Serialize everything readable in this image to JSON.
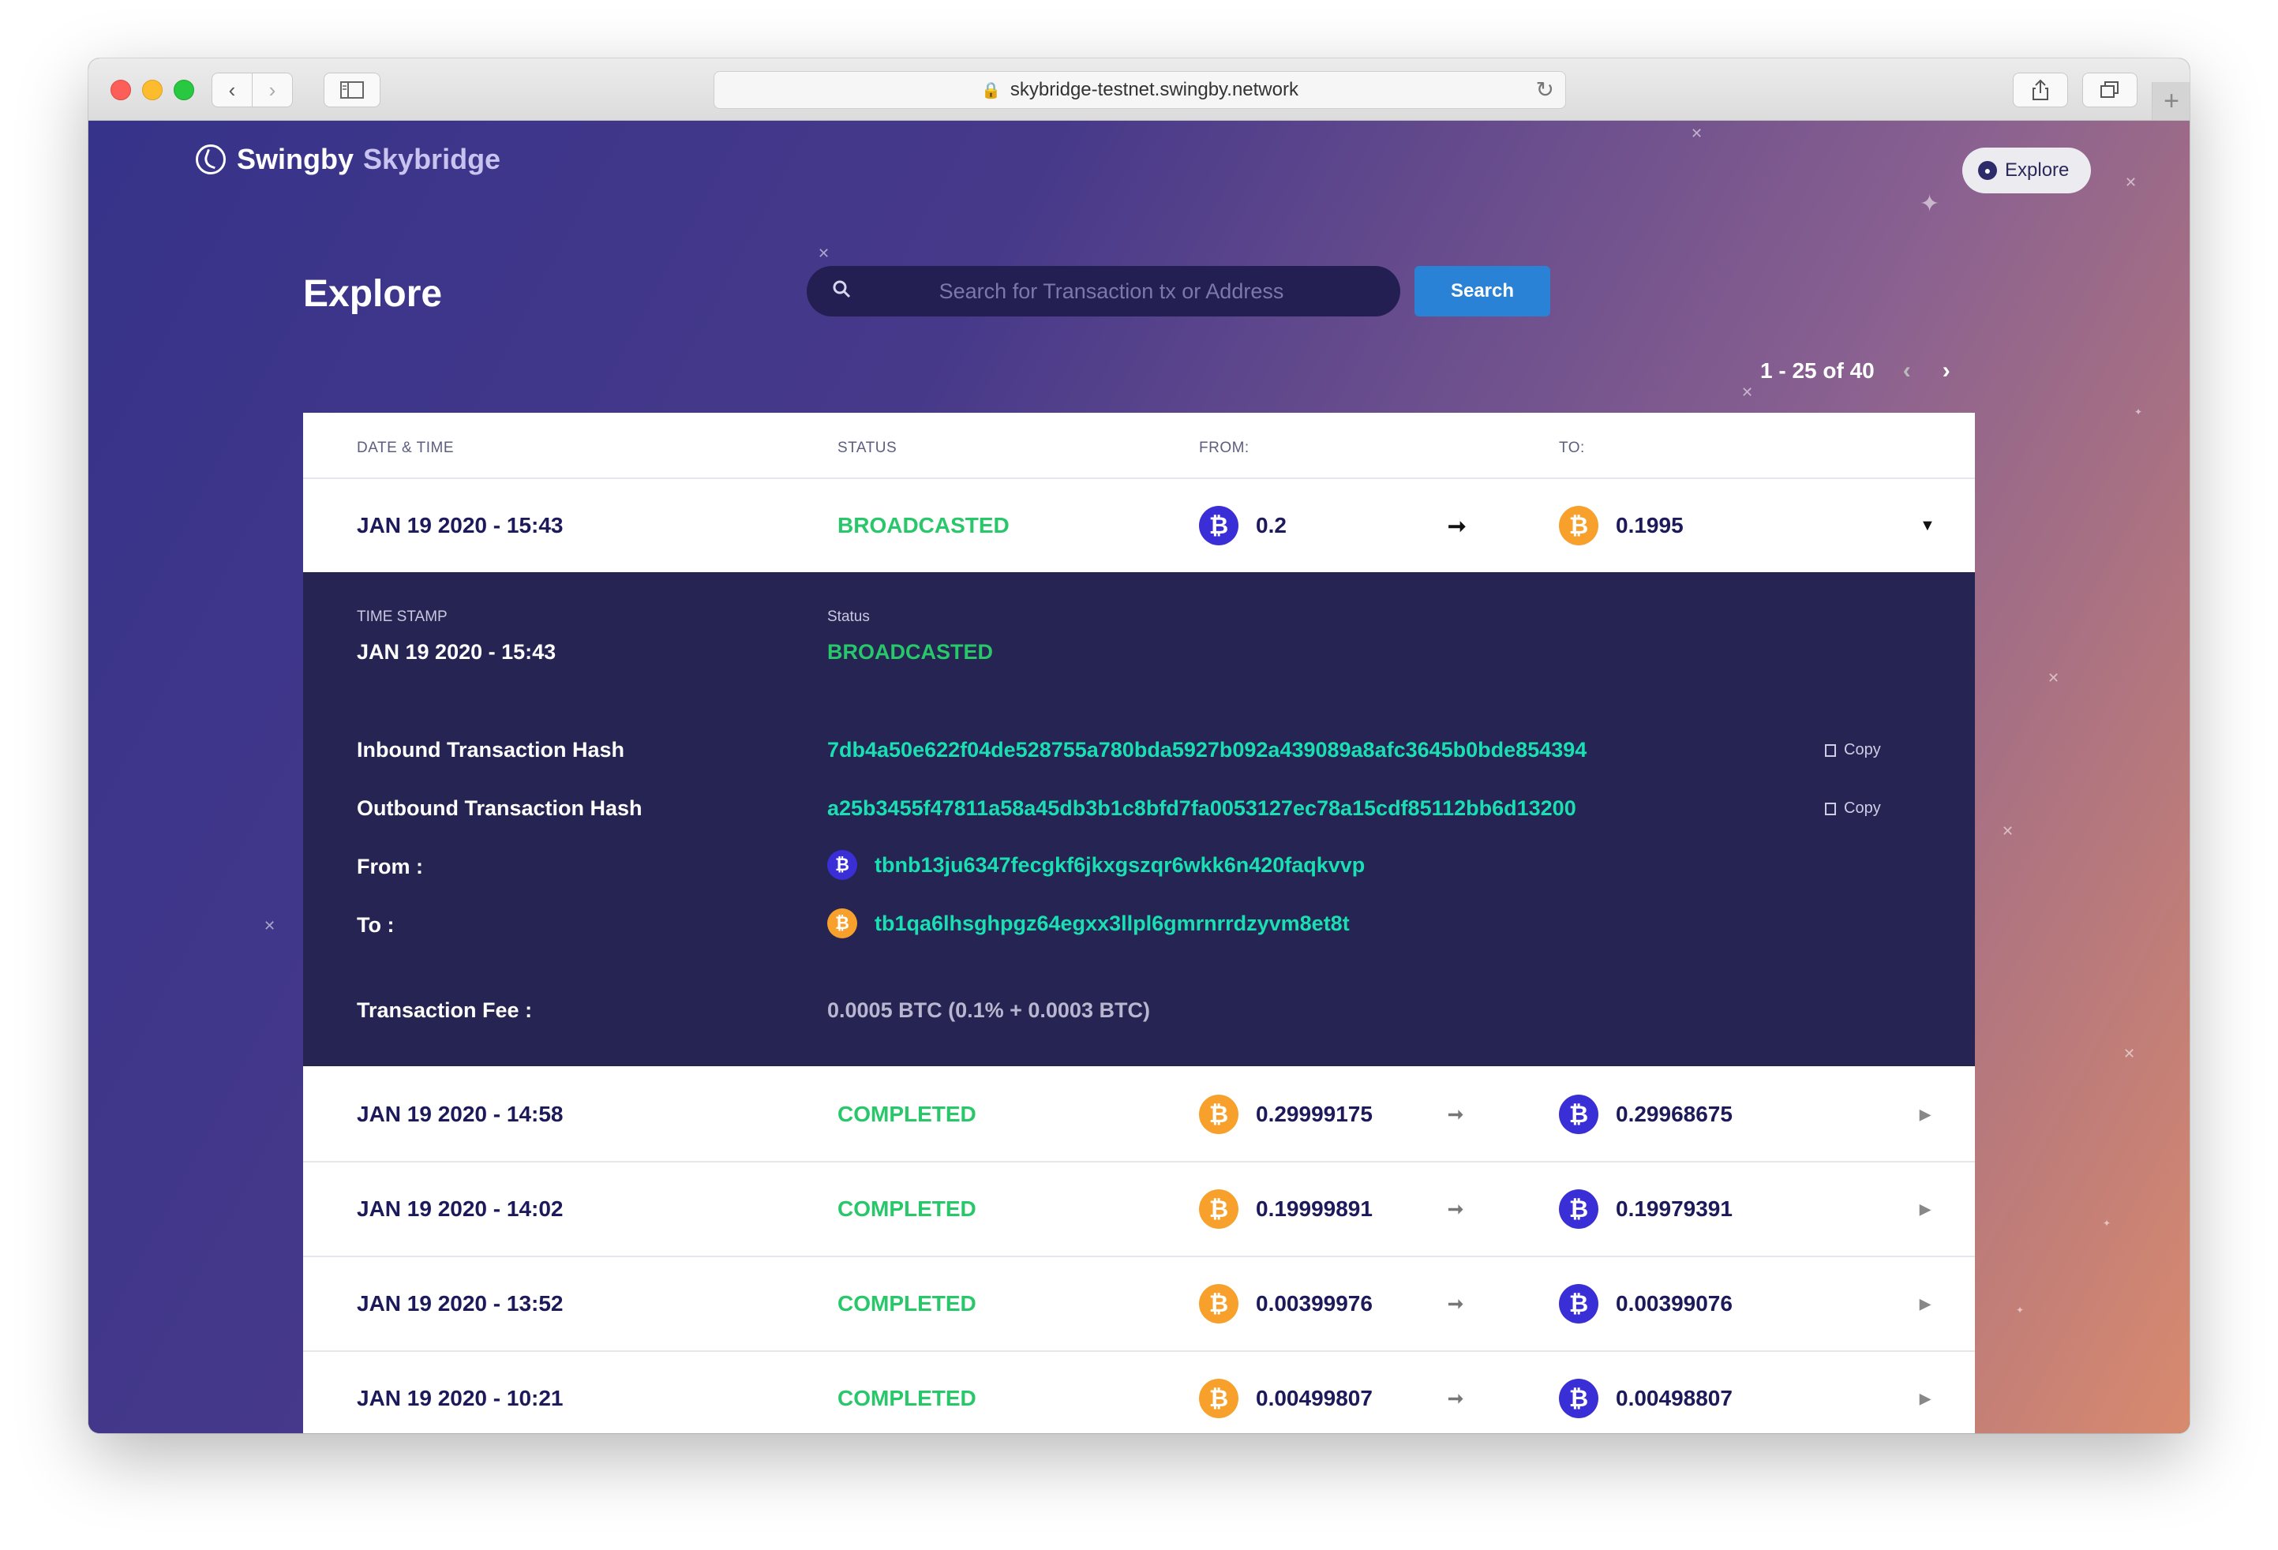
{
  "browser": {
    "url": "skybridge-testnet.swingby.network"
  },
  "header": {
    "brand_primary": "Swingby",
    "brand_secondary": "Skybridge",
    "explore_button": "Explore"
  },
  "page": {
    "title": "Explore",
    "search_placeholder": "Search for Transaction tx or Address",
    "search_button": "Search",
    "pagination": "1 - 25 of 40"
  },
  "table": {
    "columns": [
      "DATE & TIME",
      "STATUS",
      "FROM:",
      "TO:"
    ],
    "rows": [
      {
        "date": "JAN 19 2020 - 15:43",
        "status": "BROADCASTED",
        "from_amount": "0.2",
        "from_coin": "blue",
        "to_amount": "0.1995",
        "to_coin": "orange"
      },
      {
        "date": "JAN 19 2020 - 14:58",
        "status": "COMPLETED",
        "from_amount": "0.29999175",
        "from_coin": "orange",
        "to_amount": "0.29968675",
        "to_coin": "blue"
      },
      {
        "date": "JAN 19 2020 - 14:02",
        "status": "COMPLETED",
        "from_amount": "0.19999891",
        "from_coin": "orange",
        "to_amount": "0.19979391",
        "to_coin": "blue"
      },
      {
        "date": "JAN 19 2020 - 13:52",
        "status": "COMPLETED",
        "from_amount": "0.00399976",
        "from_coin": "orange",
        "to_amount": "0.00399076",
        "to_coin": "blue"
      },
      {
        "date": "JAN 19 2020 - 10:21",
        "status": "COMPLETED",
        "from_amount": "0.00499807",
        "from_coin": "orange",
        "to_amount": "0.00498807",
        "to_coin": "blue"
      }
    ]
  },
  "detail": {
    "timestamp_label": "TIME STAMP",
    "timestamp_value": "JAN 19 2020 - 15:43",
    "status_label": "Status",
    "status_value": "BROADCASTED",
    "inbound_label": "Inbound Transaction Hash",
    "inbound_hash": "7db4a50e622f04de528755a780bda5927b092a439089a8afc3645b0bde854394",
    "outbound_label": "Outbound Transaction Hash",
    "outbound_hash": "a25b3455f47811a58a45db3b1c8bfd7fa0053127ec78a15cdf85112bb6d13200",
    "from_label": "From :",
    "from_address": "tbnb13ju6347fecgkf6jkxgszqr6wkk6n420faqkvvp",
    "to_label": "To :",
    "to_address": "tb1qa6lhsghpgz64egxx3llpl6gmrnrrdzyvm8et8t",
    "fee_label": "Transaction Fee :",
    "fee_value": "0.0005 BTC (0.1% + 0.0003 BTC)",
    "copy_label": "Copy"
  },
  "colors": {
    "status_green": "#27c76a",
    "hash_teal": "#19dfb3",
    "coin_blue": "#3a2fd6",
    "coin_orange": "#f7a02b",
    "detail_bg": "#252452"
  }
}
